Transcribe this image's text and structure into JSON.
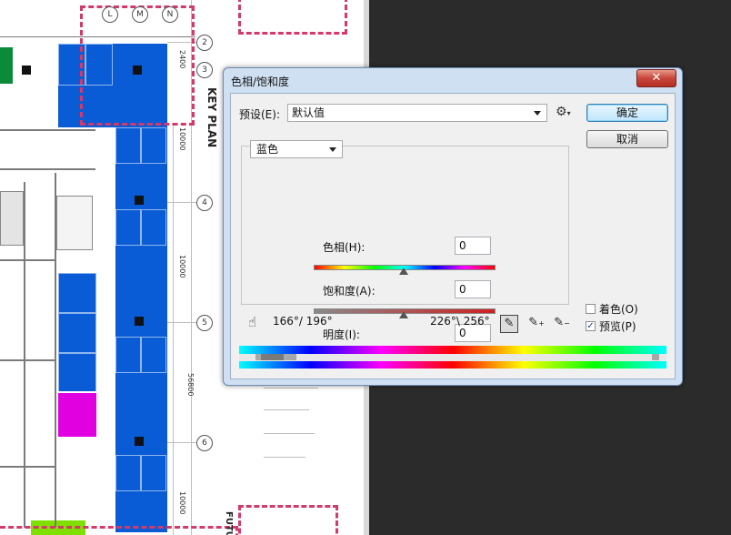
{
  "background": {
    "grid_labels": [
      "L",
      "M",
      "N",
      "2",
      "3",
      "4",
      "5",
      "6"
    ],
    "dimension_labels": [
      "2400",
      "10000",
      "10000",
      "10000",
      "56800"
    ],
    "key_plan": "KEY PLAN",
    "future_label": "FUTUR",
    "colors": {
      "blue_zone": "#0a5bd6",
      "magenta_zone": "#e000e0",
      "red_dash": "#d23a6a"
    }
  },
  "dialog": {
    "title": "色相/饱和度",
    "close_glyph": "✕",
    "preset_label": "预设(E):",
    "preset_value": "默认值",
    "ok_label": "确定",
    "cancel_label": "取消",
    "channel_value": "蓝色",
    "hue_label": "色相(H):",
    "hue_value": "0",
    "saturation_label": "饱和度(A):",
    "saturation_value": "0",
    "lightness_label": "明度(I):",
    "lightness_value": "0",
    "slider_levels": {
      "hue": 0,
      "saturation": 0,
      "lightness": 0
    },
    "range_left": "166°/ 196°",
    "range_right": "226°\\ 256°",
    "colorize_label": "着色(O)",
    "colorize_checked": false,
    "preview_label": "预览(P)",
    "preview_checked": true,
    "check_glyph": "✓",
    "icons": [
      "settings-icon",
      "hand-icon",
      "eyedropper-icon",
      "eyedropper-plus-icon",
      "eyedropper-minus-icon"
    ],
    "accent_color": "#3c7fb1"
  }
}
